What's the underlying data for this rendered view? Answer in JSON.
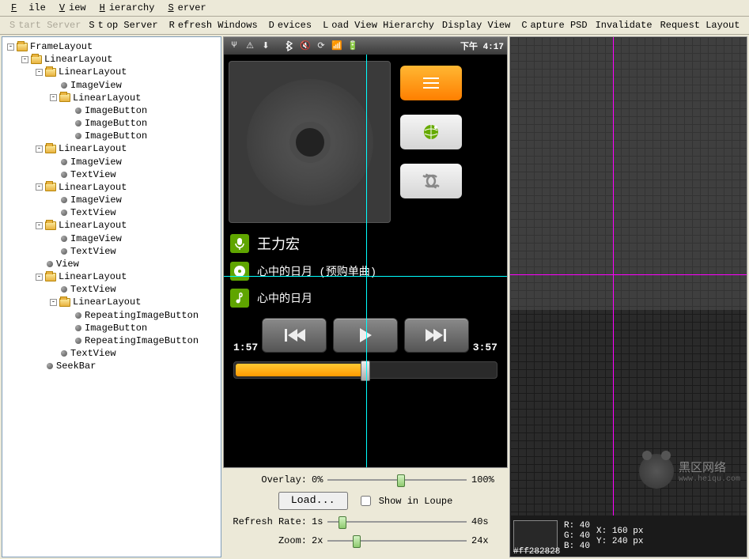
{
  "menu": {
    "file": "File",
    "view": "View",
    "hierarchy": "Hierarchy",
    "server": "Server"
  },
  "toolbar": {
    "start": "Start Server",
    "stop": "Stop Server",
    "refresh": "Refresh Windows",
    "devices": "Devices",
    "load": "Load View Hierarchy",
    "display": "Display View",
    "capture": "Capture PSD",
    "invalidate": "Invalidate",
    "request": "Request Layout"
  },
  "tree": [
    {
      "t": "folder",
      "l": "FrameLayout",
      "o": true,
      "c": [
        {
          "t": "folder",
          "l": "LinearLayout",
          "o": true,
          "c": [
            {
              "t": "folder",
              "l": "LinearLayout",
              "o": true,
              "c": [
                {
                  "t": "node",
                  "l": "ImageView"
                },
                {
                  "t": "folder",
                  "l": "LinearLayout",
                  "o": true,
                  "c": [
                    {
                      "t": "node",
                      "l": "ImageButton"
                    },
                    {
                      "t": "node",
                      "l": "ImageButton"
                    },
                    {
                      "t": "node",
                      "l": "ImageButton"
                    }
                  ]
                }
              ]
            },
            {
              "t": "folder",
              "l": "LinearLayout",
              "o": true,
              "c": [
                {
                  "t": "node",
                  "l": "ImageView"
                },
                {
                  "t": "node",
                  "l": "TextView"
                }
              ]
            },
            {
              "t": "folder",
              "l": "LinearLayout",
              "o": true,
              "c": [
                {
                  "t": "node",
                  "l": "ImageView"
                },
                {
                  "t": "node",
                  "l": "TextView"
                }
              ]
            },
            {
              "t": "folder",
              "l": "LinearLayout",
              "o": true,
              "c": [
                {
                  "t": "node",
                  "l": "ImageView"
                },
                {
                  "t": "node",
                  "l": "TextView"
                }
              ]
            },
            {
              "t": "node",
              "l": "View"
            },
            {
              "t": "folder",
              "l": "LinearLayout",
              "o": true,
              "c": [
                {
                  "t": "node",
                  "l": "TextView"
                },
                {
                  "t": "folder",
                  "l": "LinearLayout",
                  "o": true,
                  "c": [
                    {
                      "t": "node",
                      "l": "RepeatingImageButton"
                    },
                    {
                      "t": "node",
                      "l": "ImageButton"
                    },
                    {
                      "t": "node",
                      "l": "RepeatingImageButton"
                    }
                  ]
                },
                {
                  "t": "node",
                  "l": "TextView"
                }
              ]
            },
            {
              "t": "node",
              "l": "SeekBar"
            }
          ]
        }
      ]
    }
  ],
  "status": {
    "time": "下午 4:17"
  },
  "now": {
    "artist": "王力宏",
    "album": "心中的日月 (预购单曲)",
    "track": "心中的日月"
  },
  "player": {
    "elapsed": "1:57",
    "total": "3:57"
  },
  "overlay": {
    "label": "Overlay:",
    "min": "0%",
    "max": "100%",
    "thumb": 50
  },
  "load": {
    "btn": "Load...",
    "check": "Show in Loupe"
  },
  "refresh": {
    "label": "Refresh Rate:",
    "min": "1s",
    "max": "40s",
    "thumb": 8
  },
  "zoom": {
    "label": "Zoom:",
    "min": "2x",
    "max": "24x",
    "thumb": 18
  },
  "readout": {
    "hex": "#ff282828",
    "r": "R: 40",
    "g": "G: 40",
    "b": "B: 40",
    "x": "X: 160 px",
    "y": "Y: 240 px"
  },
  "watermark": {
    "text": "黑区网络",
    "url": "www.heiqu.com"
  }
}
